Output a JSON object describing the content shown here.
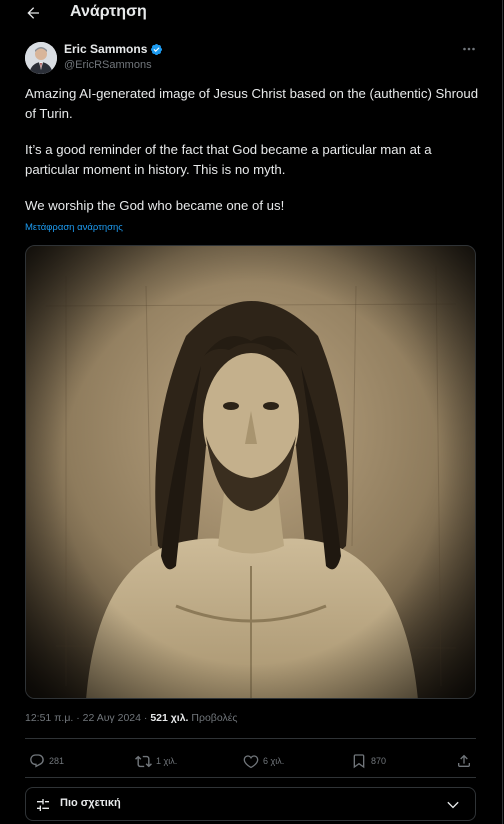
{
  "header": {
    "title": "Ανάρτηση",
    "back_icon": "arrow-left-icon"
  },
  "author": {
    "name": "Eric Sammons",
    "handle": "@EricRSammons",
    "verified_color": "#1d9bf0"
  },
  "tweet": {
    "paragraphs": [
      "Amazing AI-generated image of Jesus Christ based on the (authentic) Shroud of Turin.",
      "It’s a good reminder of the fact that God became a particular man at a particular moment in history. This is no myth.",
      "We worship the God who became one of us!"
    ],
    "translate_label": "Μετάφραση ανάρτησης"
  },
  "meta": {
    "time": "12:51 π.μ.",
    "separator": " · ",
    "date": "22 Αυγ 2024",
    "dot": " · ",
    "views_count": "521 χιλ.",
    "views_label": " Προβολές"
  },
  "actions": {
    "replies": "281",
    "reposts": "1 χιλ.",
    "likes": "6 χιλ.",
    "bookmarks": "870"
  },
  "sort": {
    "label": "Πιο σχετική"
  },
  "colors": {
    "accent": "#1d9bf0",
    "muted": "#71767b",
    "text": "#e7e9ea",
    "border": "#2f3336"
  }
}
